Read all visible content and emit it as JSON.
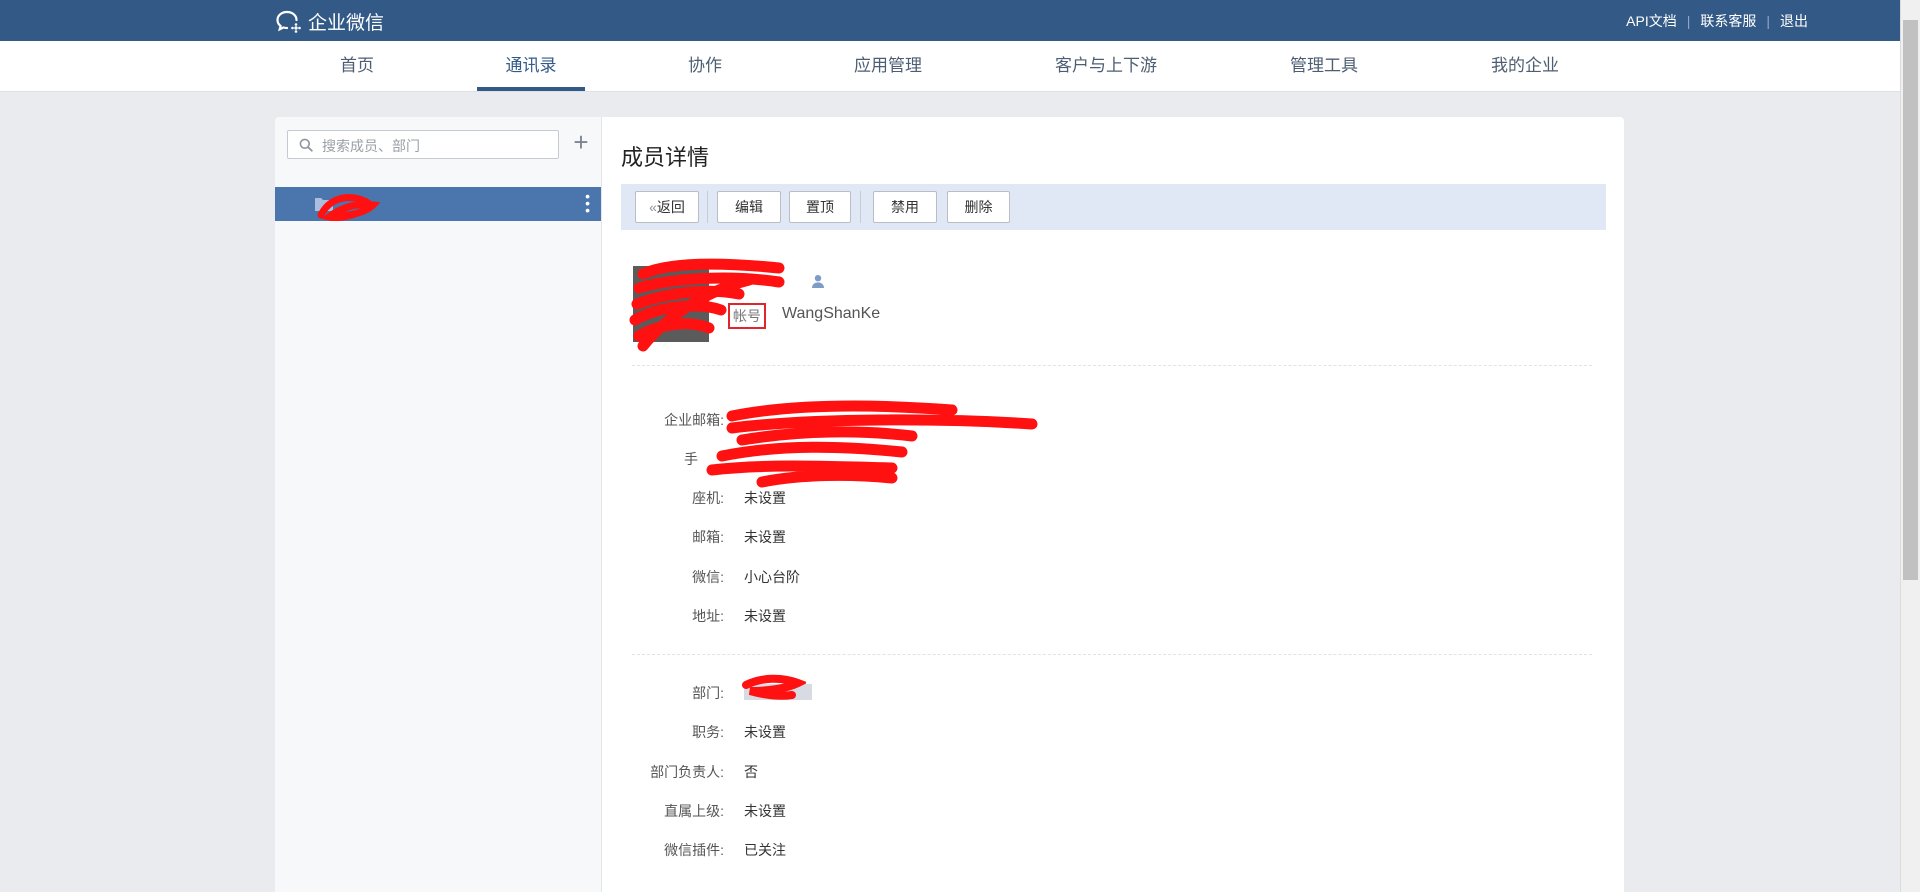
{
  "top": {
    "brand": "企业微信",
    "links": [
      "API文档",
      "联系客服",
      "退出"
    ]
  },
  "nav": {
    "items": [
      "首页",
      "通讯录",
      "协作",
      "应用管理",
      "客户与上下游",
      "管理工具",
      "我的企业"
    ],
    "active_index": 1
  },
  "sidebar": {
    "search_placeholder": "搜索成员、部门",
    "add_symbol": "+",
    "tree": [
      {
        "label": "",
        "selected": true
      }
    ],
    "more_symbol": "⋮"
  },
  "main": {
    "title": "成员详情",
    "toolbar": {
      "back_label": "返回",
      "edit_label": "编辑",
      "pin_label": "置顶",
      "disable_label": "禁用",
      "delete_label": "删除"
    },
    "member": {
      "name": "",
      "account_label": "帐号",
      "account_value": "WangShanKe"
    },
    "contact_fields": [
      {
        "label": "企业邮箱:",
        "value": ""
      },
      {
        "label": "手",
        "value": ""
      },
      {
        "label": "座机:",
        "value": "未设置"
      },
      {
        "label": "邮箱:",
        "value": "未设置"
      },
      {
        "label": "微信:",
        "value": "小心台阶"
      },
      {
        "label": "地址:",
        "value": "未设置"
      }
    ],
    "org_fields": [
      {
        "label": "部门:",
        "value": ""
      },
      {
        "label": "职务:",
        "value": "未设置"
      },
      {
        "label": "部门负责人:",
        "value": "否"
      },
      {
        "label": "直属上级:",
        "value": "未设置"
      },
      {
        "label": "微信插件:",
        "value": "已关注"
      }
    ]
  },
  "colors": {
    "topbar": "#335a87",
    "accent": "#335a87",
    "selected_row": "#4a76ad",
    "toolbar_bg": "#dfe8f4",
    "redaction": "#ff1111"
  }
}
